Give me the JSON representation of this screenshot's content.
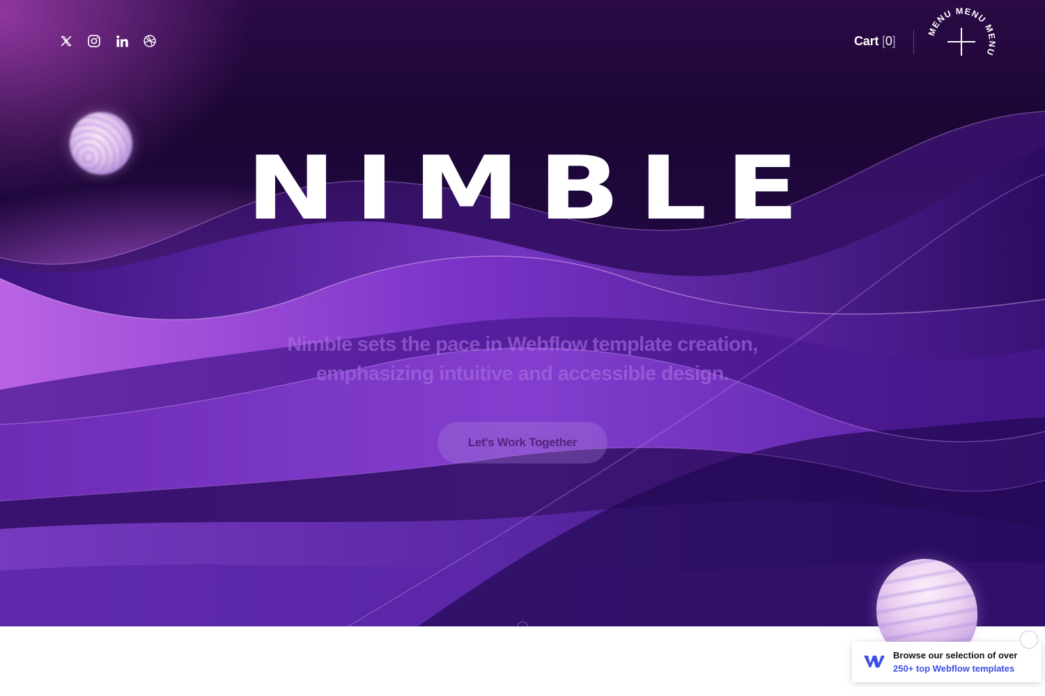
{
  "socials": [
    {
      "name": "x-icon"
    },
    {
      "name": "instagram-icon"
    },
    {
      "name": "linkedin-icon"
    },
    {
      "name": "dribbble-icon"
    }
  ],
  "cart": {
    "label": "Cart",
    "open": "[",
    "count": "0",
    "close": "]"
  },
  "menu": {
    "ring_text": "MENU MENU MENU"
  },
  "hero": {
    "title": "NIMBLE",
    "subtitle_line1": "Nimble sets the pace in Webflow template creation,",
    "subtitle_line2": "emphasizing intuitive and accessible design.",
    "cta_label": "Let's Work Together"
  },
  "promo": {
    "line1": "Browse our selection of over",
    "line2": "250+ top Webflow templates",
    "logo": "webflow-logo-icon"
  },
  "colors": {
    "hero_bg": "#1b0634",
    "accent_purple": "#8a3be0",
    "promo_link": "#3b4fe6"
  }
}
